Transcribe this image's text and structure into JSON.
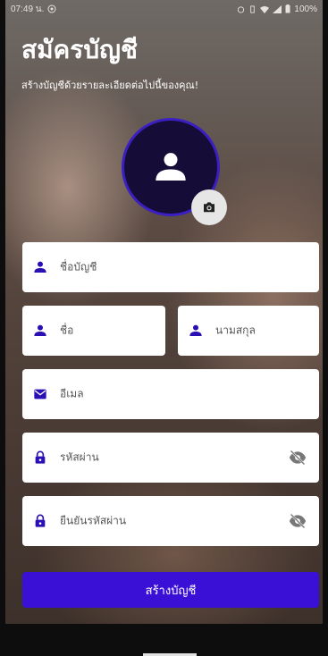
{
  "status_bar": {
    "time": "07:49 น.",
    "battery": "100%"
  },
  "header": {
    "title": "สมัครบัญชี",
    "subtitle": "สร้างบัญชีด้วยรายละเอียดต่อไปนี้ของคุณ!"
  },
  "avatar": {
    "icon": "user-icon",
    "camera_icon": "camera-icon"
  },
  "form": {
    "username_placeholder": "ชื่อบัญชี",
    "first_name_placeholder": "ชื่อ",
    "last_name_placeholder": "นามสกุล",
    "email_placeholder": "อีเมล",
    "password_placeholder": "รหัสผ่าน",
    "confirm_password_placeholder": "ยืนยันรหัสผ่าน"
  },
  "actions": {
    "create_label": "สร้างบัญชี"
  },
  "colors": {
    "accent": "#3a10d6",
    "avatar_bg": "#150c38",
    "avatar_ring": "#3b1fc2",
    "icon": "#2a0fb5"
  }
}
